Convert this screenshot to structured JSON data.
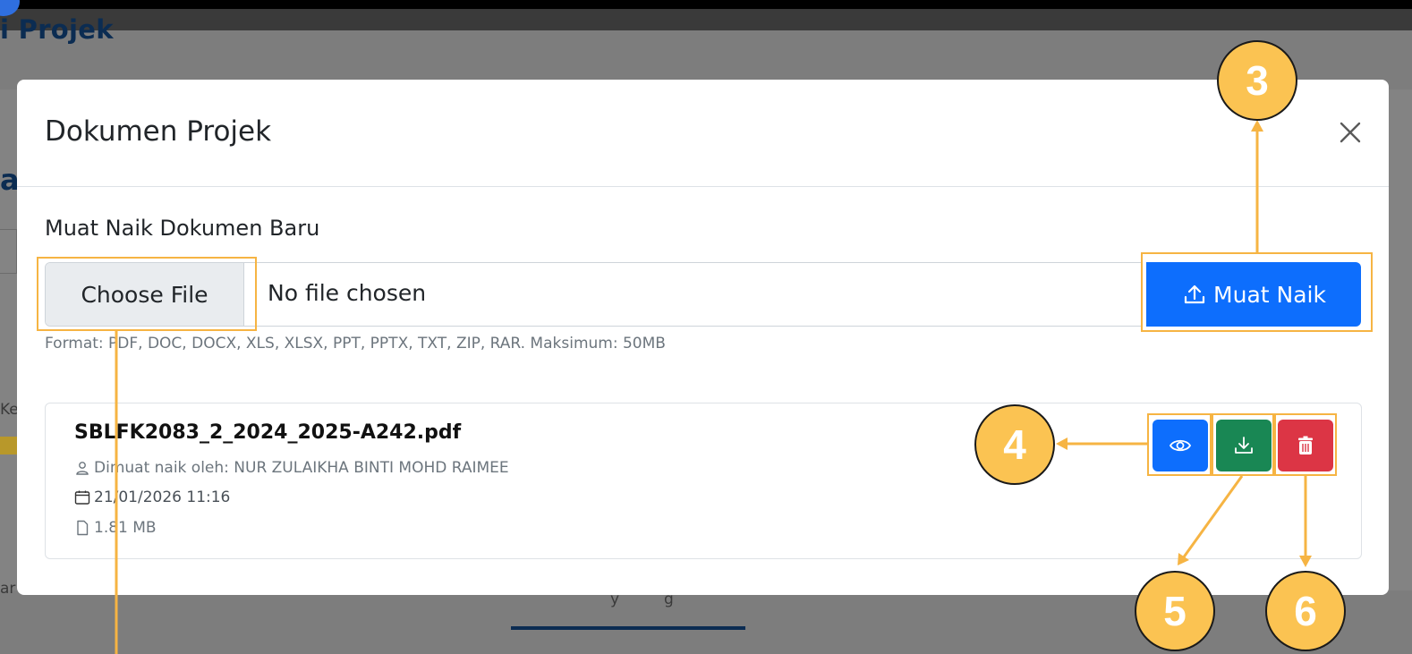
{
  "background": {
    "page_title_fragment": "i Projek",
    "frag_a": "a",
    "frag_k": "Ke",
    "frag_ar": "ar",
    "frag_y": "y",
    "frag_g": "g"
  },
  "modal": {
    "title": "Dokumen Projek",
    "close_icon": "close-icon",
    "upload_section": {
      "label": "Muat Naik Dokumen Baru",
      "choose_file_label": "Choose File",
      "file_status": "No file chosen",
      "upload_button_label": "Muat Naik",
      "upload_icon": "upload-icon",
      "format_hint": "Format: PDF, DOC, DOCX, XLS, XLSX, PPT, PPTX, TXT, ZIP, RAR. Maksimum: 50MB"
    },
    "documents": [
      {
        "file_name": "SBLFK2083_2_2024_2025-A242.pdf",
        "uploaded_by": "Dimuat naik oleh: NUR ZULAIKHA BINTI MOHD RAIMEE",
        "uploaded_at": "21/01/2026 11:16",
        "size": "1.81 MB",
        "actions": [
          "view-icon",
          "download-icon",
          "trash-icon"
        ]
      }
    ]
  },
  "callouts": [
    "3",
    "4",
    "5",
    "6"
  ],
  "colors": {
    "primary": "#0d6efd",
    "success": "#198754",
    "danger": "#dc3545",
    "callout_fill": "#fbc352",
    "callout_line": "#f6b443",
    "overlay": "#7d7d7d"
  }
}
